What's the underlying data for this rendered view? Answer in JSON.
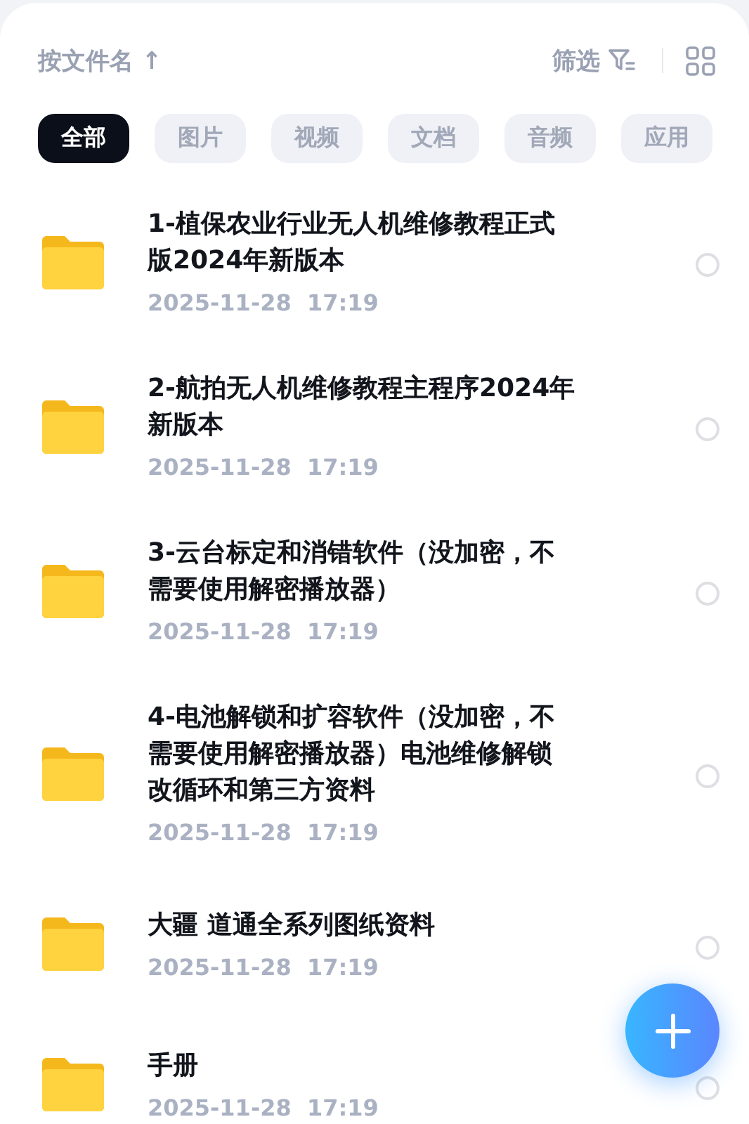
{
  "sort": {
    "label": "按文件名",
    "arrow": "↑"
  },
  "filter": {
    "label": "筛选"
  },
  "tabs": [
    {
      "label": "全部",
      "selected": true
    },
    {
      "label": "图片",
      "selected": false
    },
    {
      "label": "视频",
      "selected": false
    },
    {
      "label": "文档",
      "selected": false
    },
    {
      "label": "音频",
      "selected": false
    },
    {
      "label": "应用",
      "selected": false
    }
  ],
  "files": [
    {
      "name_lines": [
        "1-植保农业行业无人机维修教程正式",
        "版2024年新版本"
      ],
      "date": "2025-11-28",
      "time": "17:19",
      "selected": false
    },
    {
      "name_lines": [
        "2-航拍无人机维修教程主程序2024年",
        "新版本"
      ],
      "date": "2025-11-28",
      "time": "17:19",
      "selected": false
    },
    {
      "name_lines": [
        "3-云台标定和消错软件（没加密，不",
        "需要使用解密播放器）"
      ],
      "date": "2025-11-28",
      "time": "17:19",
      "selected": false
    },
    {
      "name_lines": [
        "4-电池解锁和扩容软件（没加密，不",
        "需要使用解密播放器）电池维修解锁",
        "改循环和第三方资料"
      ],
      "date": "2025-11-28",
      "time": "17:19",
      "selected": false
    },
    {
      "name_lines": [
        "大疆 道通全系列图纸资料"
      ],
      "date": "2025-11-28",
      "time": "17:19",
      "selected": false
    },
    {
      "name_lines": [
        "手册"
      ],
      "date": "2025-11-28",
      "time": "17:19",
      "selected": false
    }
  ]
}
